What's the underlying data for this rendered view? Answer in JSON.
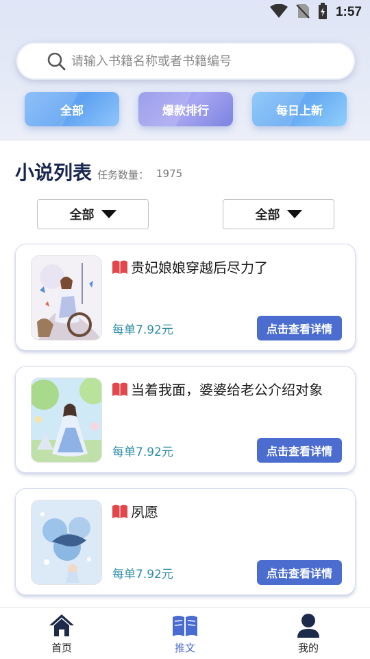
{
  "status": {
    "time": "1:57"
  },
  "search": {
    "placeholder": "请输入书籍名称或者书籍编号"
  },
  "filters": [
    {
      "label": "全部"
    },
    {
      "label": "爆款排行"
    },
    {
      "label": "每日上新"
    }
  ],
  "section": {
    "title": "小说列表",
    "task_label": "任务数量：",
    "task_count": "1975"
  },
  "dropdowns": [
    {
      "label": "全部"
    },
    {
      "label": "全部"
    }
  ],
  "books": [
    {
      "title": "贵妃娘娘穿越后尽力了",
      "price": "每单7.92元",
      "button": "点击查看详情"
    },
    {
      "title": "当着我面，婆婆给老公介绍对象",
      "price": "每单7.92元",
      "button": "点击查看详情"
    },
    {
      "title": "夙愿",
      "price": "每单7.92元",
      "button": "点击查看详情"
    }
  ],
  "tabbar": {
    "items": [
      {
        "label": "首页",
        "icon": "home-icon"
      },
      {
        "label": "推文",
        "icon": "book-icon"
      },
      {
        "label": "我的",
        "icon": "user-icon"
      }
    ],
    "active_color": "#4a6bd1"
  },
  "colors": {
    "accent": "#4c6dd0",
    "price": "#2d8ca5",
    "title": "#1a2650"
  }
}
